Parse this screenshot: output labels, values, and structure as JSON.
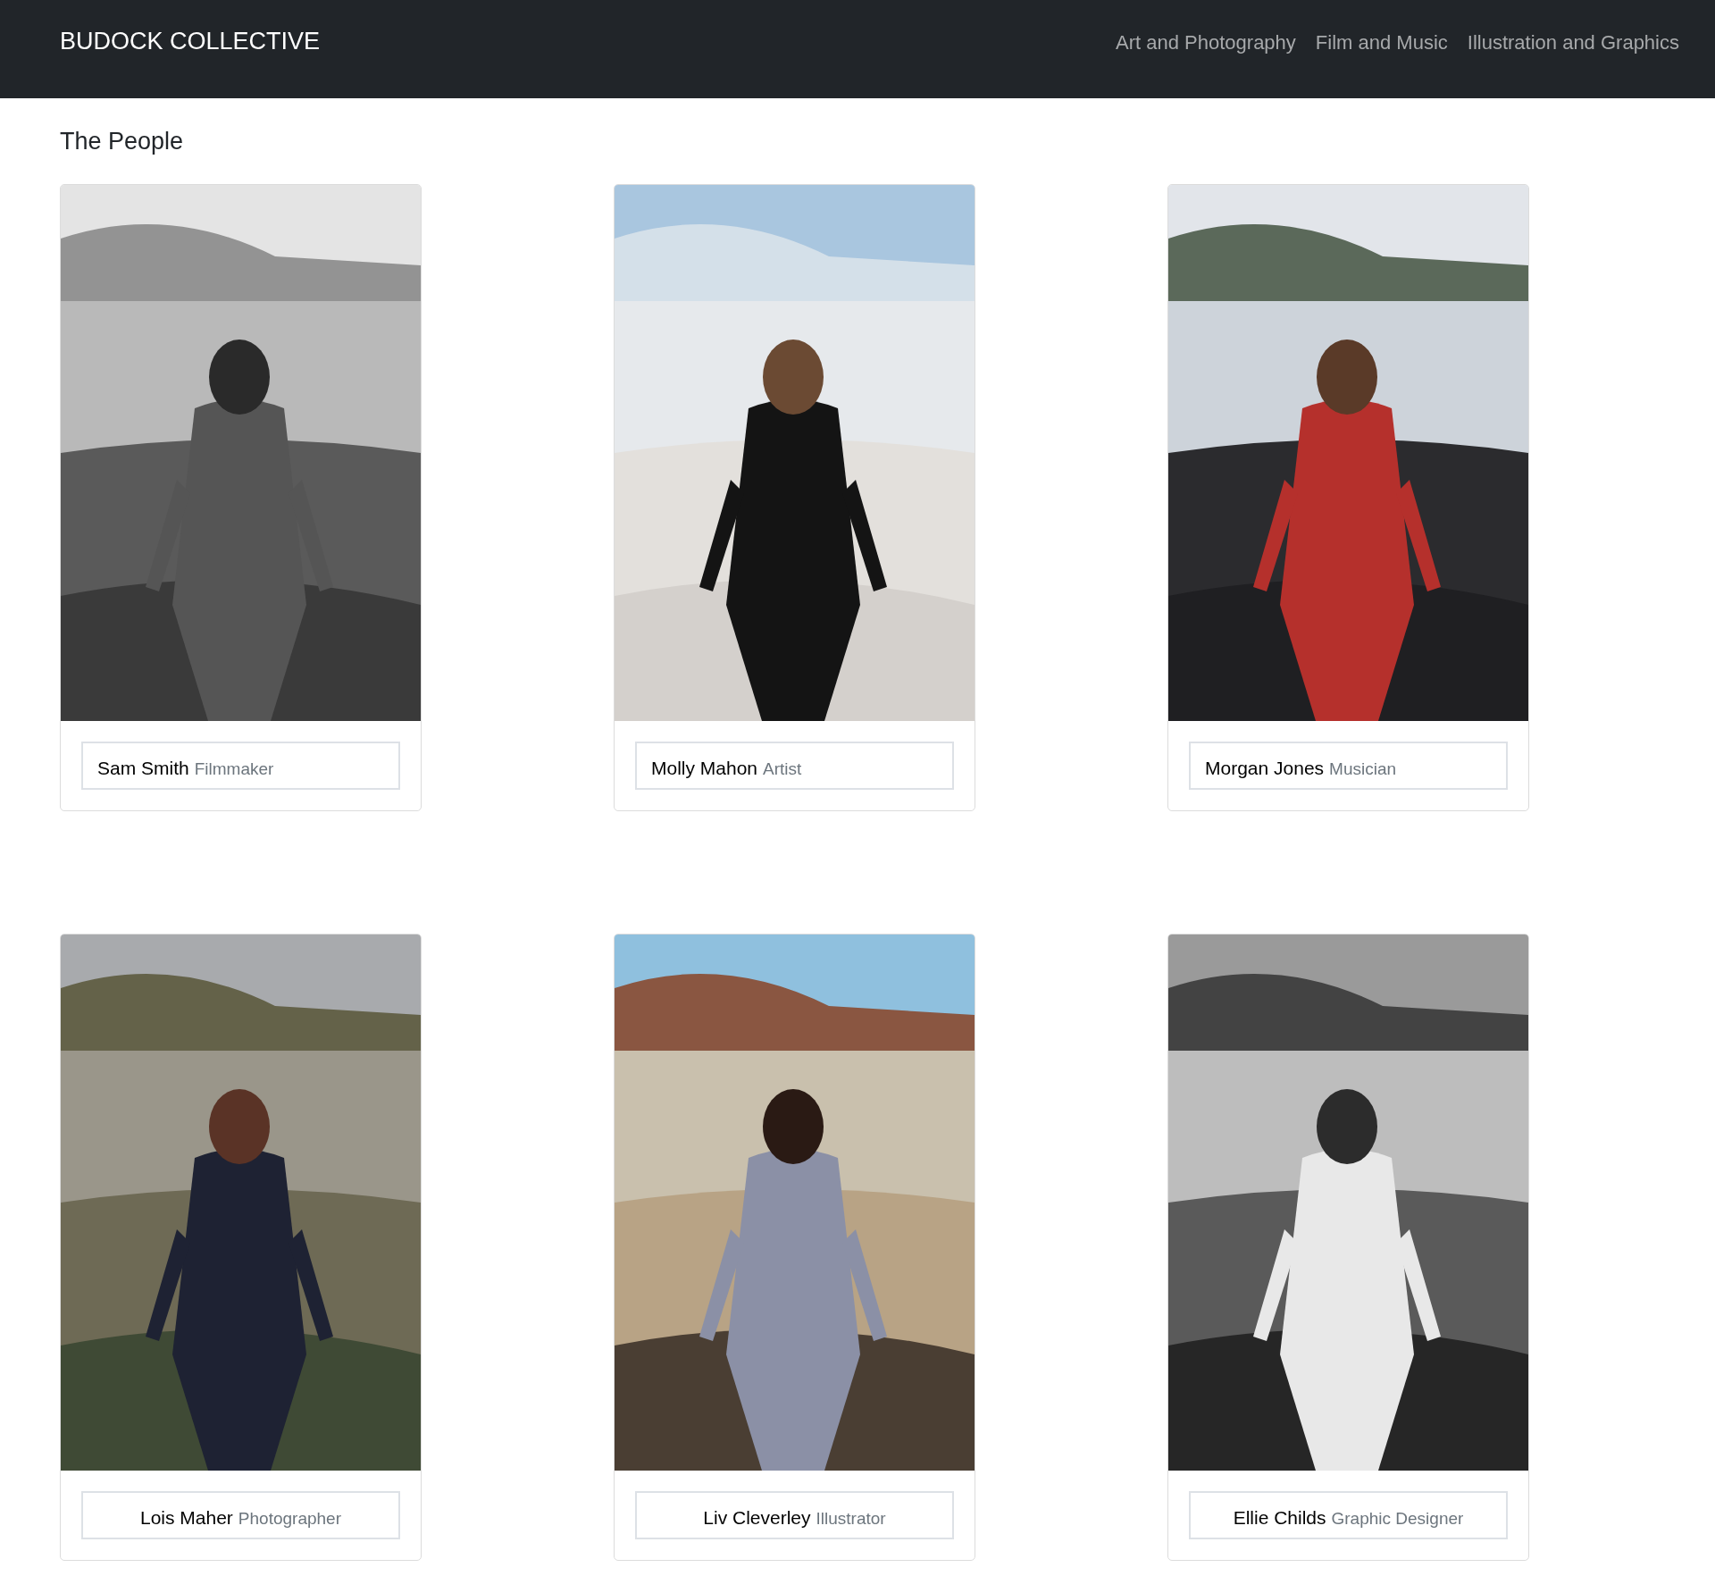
{
  "navbar": {
    "brand": "BUDOCK COLLECTIVE",
    "links": [
      "Art and Photography",
      "Film and Music",
      "Illustration and Graphics"
    ]
  },
  "heading": "The People",
  "people": [
    {
      "name": "Sam Smith",
      "role": "Filmmaker",
      "kind": "left"
    },
    {
      "name": "Molly Mahon",
      "role": "Artist",
      "kind": "left"
    },
    {
      "name": "Morgan Jones",
      "role": "Musician",
      "kind": "left"
    },
    {
      "name": "Lois Maher",
      "role": "Photographer",
      "kind": "centered"
    },
    {
      "name": "Liv Cleverley",
      "role": "Illustrator",
      "kind": "centered"
    },
    {
      "name": "Ellie Childs",
      "role": "Graphic Designer",
      "kind": "centered"
    }
  ]
}
